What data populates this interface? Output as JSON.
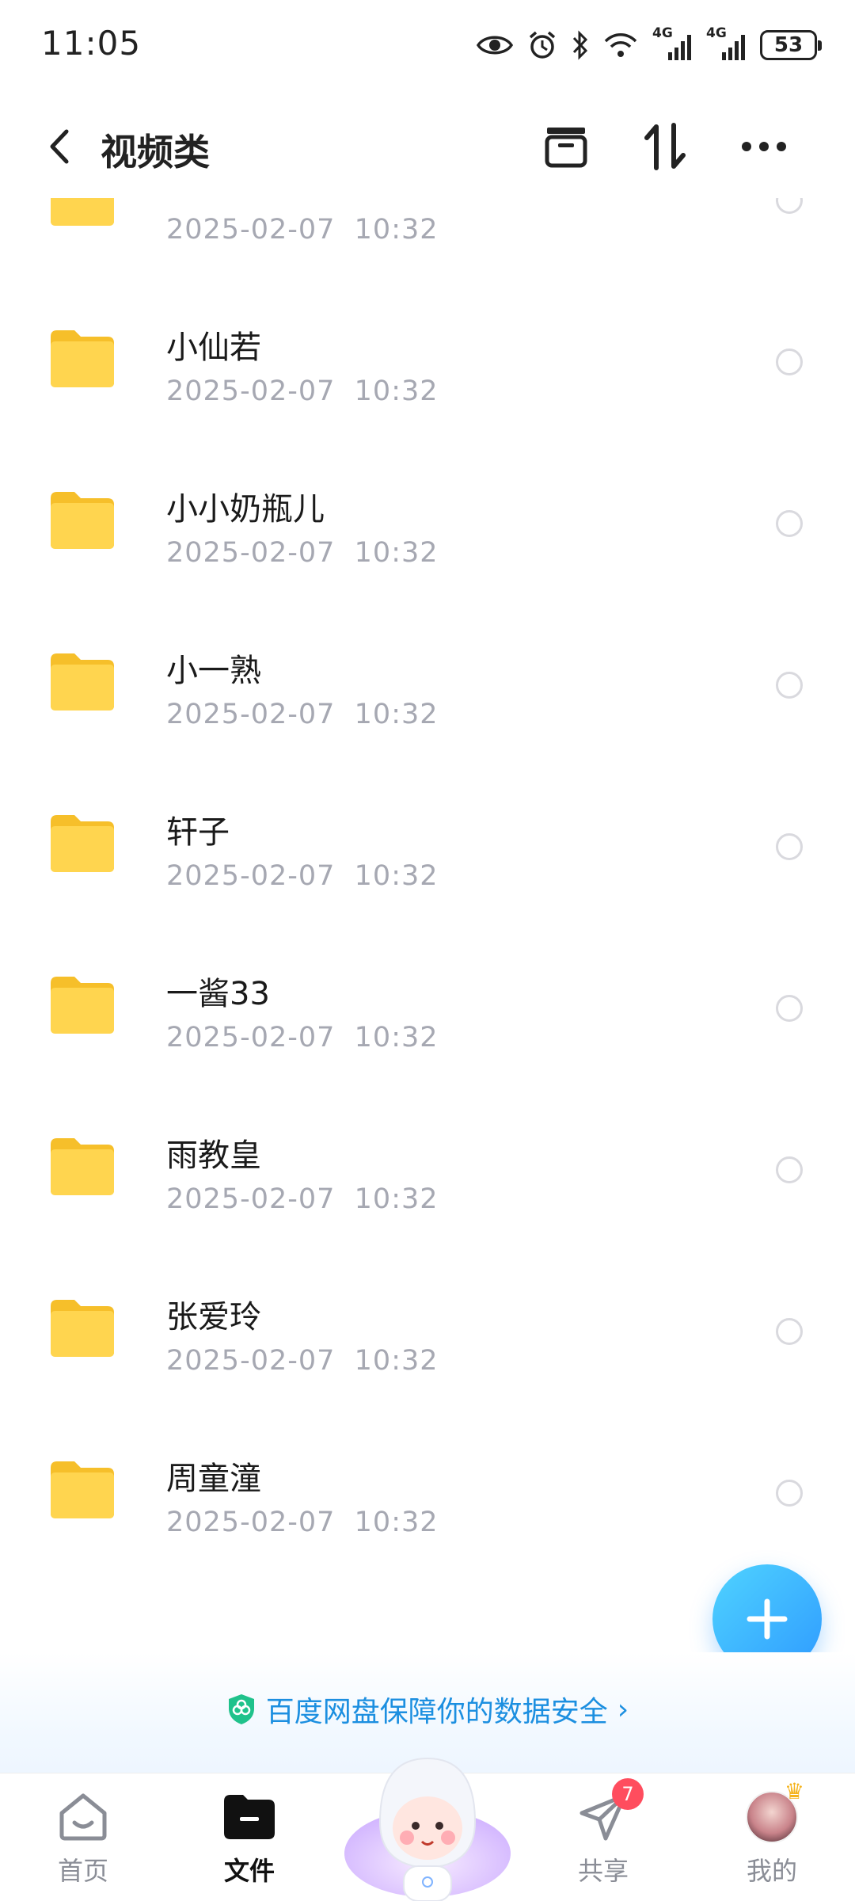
{
  "status_bar": {
    "time": "11:05",
    "network_1": "4G",
    "network_2": "4G",
    "battery": "53"
  },
  "header": {
    "title": "视频类"
  },
  "folders": [
    {
      "name": "",
      "date": "2025-02-07  10:32"
    },
    {
      "name": "小仙若",
      "date": "2025-02-07  10:32"
    },
    {
      "name": "小小奶瓶儿",
      "date": "2025-02-07  10:32"
    },
    {
      "name": "小一熟",
      "date": "2025-02-07  10:32"
    },
    {
      "name": "轩子",
      "date": "2025-02-07  10:32"
    },
    {
      "name": "一酱33",
      "date": "2025-02-07  10:32"
    },
    {
      "name": "雨教皇",
      "date": "2025-02-07  10:32"
    },
    {
      "name": "张爱玲",
      "date": "2025-02-07  10:32"
    },
    {
      "name": "周童潼",
      "date": "2025-02-07  10:32"
    }
  ],
  "banner": {
    "text": "百度网盘保障你的数据安全"
  },
  "bottom_nav": {
    "items": [
      {
        "label": "首页",
        "icon": "home-icon"
      },
      {
        "label": "文件",
        "icon": "folder-icon",
        "active": true
      },
      {
        "label": "共享",
        "icon": "share-send-icon",
        "badge": "7"
      },
      {
        "label": "我的",
        "icon": "avatar"
      }
    ]
  },
  "colors": {
    "accent": "#2f9bff",
    "folder": "#ffd24a",
    "date_text": "#a6a8b2",
    "badge": "#ff4d5e",
    "banner_text": "#1c8fe0"
  }
}
